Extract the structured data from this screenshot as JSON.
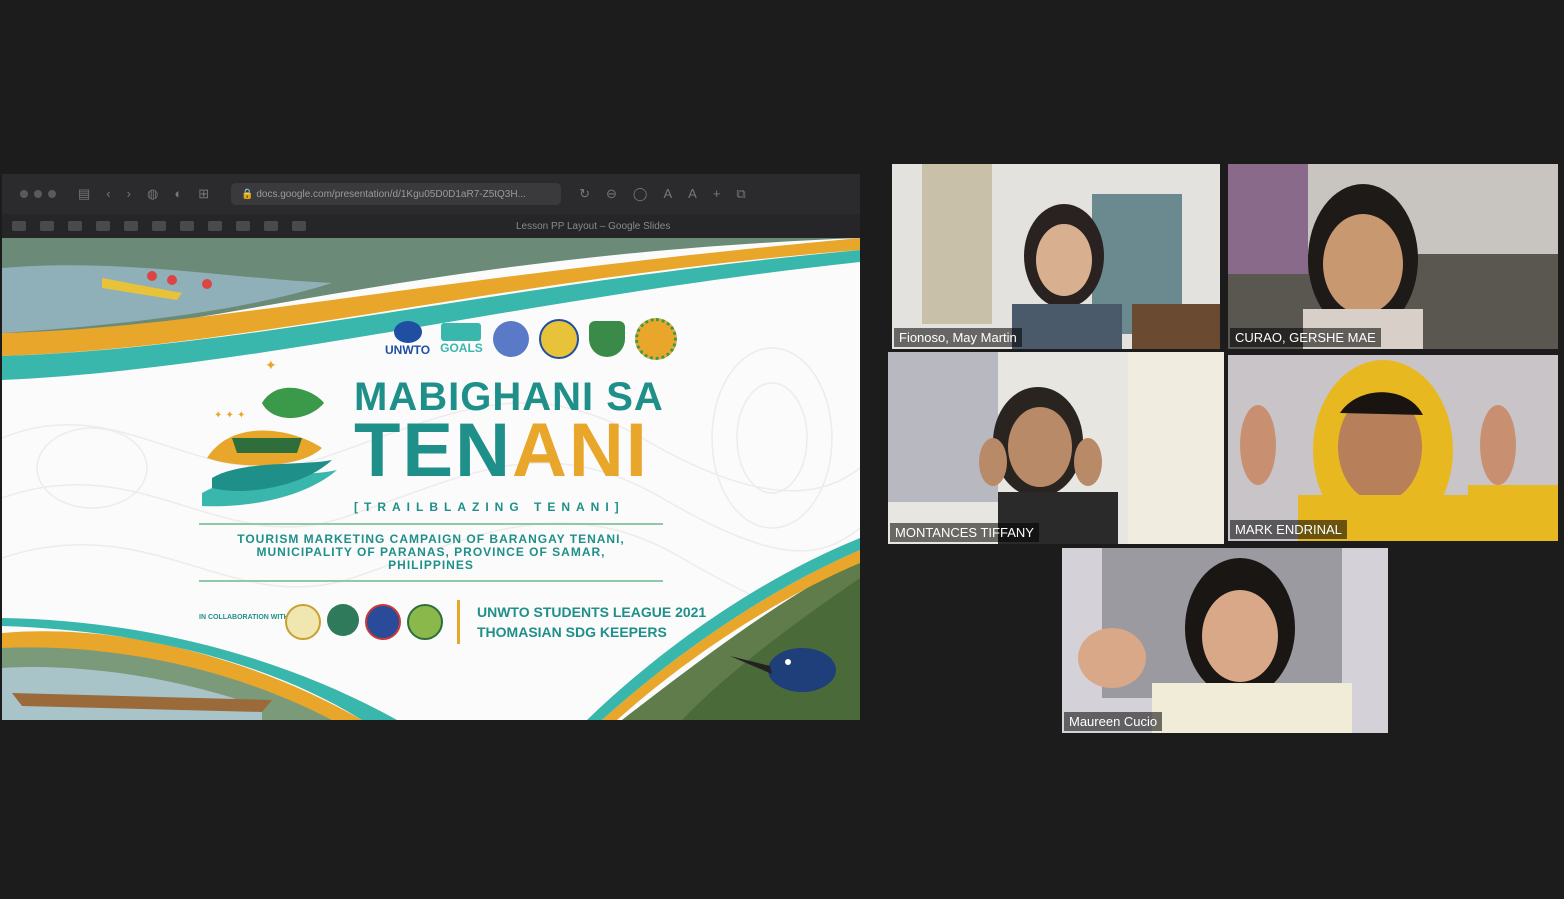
{
  "share": {
    "url": "docs.google.com/presentation/d/1Kgu05D0D1aR7-Z5tQ3H...",
    "doc_title": "Lesson PP Layout – Google Slides",
    "slide": {
      "logo_text": "UNWTO",
      "logo_goals": "GOALS",
      "title_line1": "MABIGHANI SA",
      "title_line2_a": "TEN",
      "title_line2_b": "A",
      "title_line2_c": "NI",
      "subtitle": "[TRAILBLAZING TENANI]",
      "campaign_line1": "TOURISM MARKETING CAMPAIGN OF BARANGAY TENANI,",
      "campaign_line2": "MUNICIPALITY OF PARANAS, PROVINCE OF SAMAR,",
      "campaign_line3": "PHILIPPINES",
      "collab_label": "IN COLLABORATION WITH",
      "league_line1": "UNWTO STUDENTS LEAGUE 2021",
      "league_line2": "THOMASIAN SDG KEEPERS"
    }
  },
  "participants": [
    {
      "name": "Fionoso, May Martin"
    },
    {
      "name": "CURAO, GERSHE MAE"
    },
    {
      "name": "MONTANCES TIFFANY"
    },
    {
      "name": "MARK ENDRINAL"
    },
    {
      "name": "Maureen Cucio"
    }
  ],
  "colors": {
    "teal": "#1f8f8a",
    "gold": "#e8a62a",
    "active_speaker": "#d8e27a",
    "background": "#1c1c1c"
  }
}
